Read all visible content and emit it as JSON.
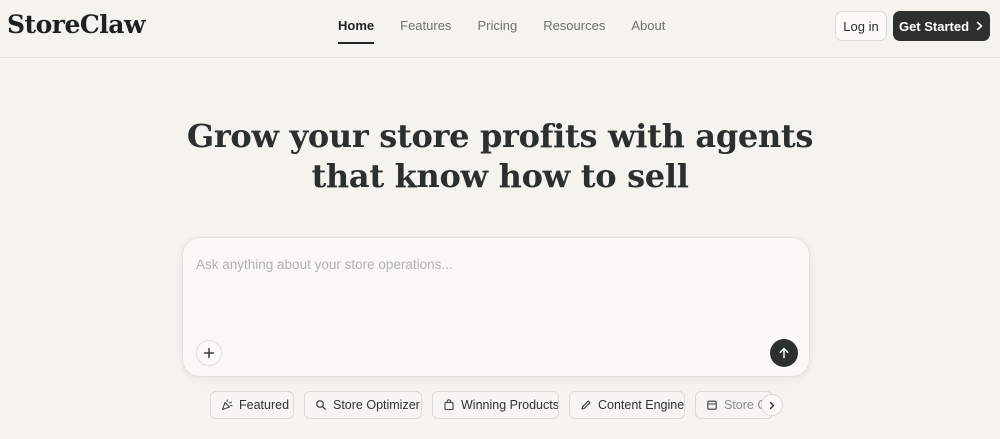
{
  "brand": {
    "name": "StoreClaw"
  },
  "nav": {
    "items": [
      {
        "label": "Home",
        "active": true
      },
      {
        "label": "Features",
        "active": false
      },
      {
        "label": "Pricing",
        "active": false
      },
      {
        "label": "Resources",
        "active": false
      },
      {
        "label": "About",
        "active": false
      }
    ]
  },
  "header_actions": {
    "login_label": "Log in",
    "get_started_label": "Get Started"
  },
  "hero": {
    "line1": "Grow your store profits with agents",
    "line2": "that know how to sell"
  },
  "chat": {
    "placeholder": "Ask anything about your store operations..."
  },
  "chips": [
    {
      "label": "Featured",
      "icon": "party-popper-icon"
    },
    {
      "label": "Store Optimizer",
      "icon": "search-icon"
    },
    {
      "label": "Winning Products",
      "icon": "shopping-bag-icon"
    },
    {
      "label": "Content Engine",
      "icon": "pencil-icon"
    },
    {
      "label": "Store C",
      "icon": "store-icon"
    }
  ],
  "colors": {
    "background": "#f4f3ee",
    "primary_dark": "#2c312f",
    "muted_text": "#6f716d"
  }
}
